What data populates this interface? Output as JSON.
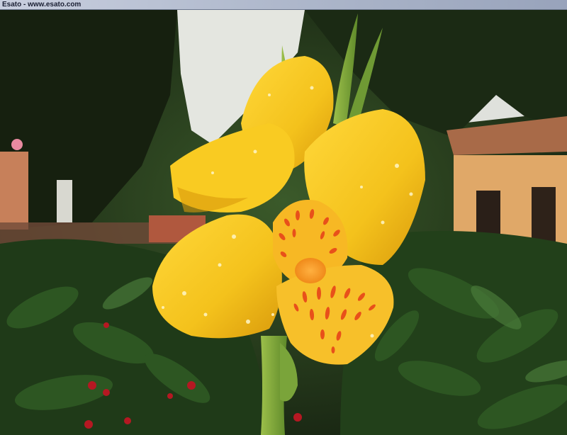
{
  "watermark": {
    "text": "Esato - www.esato.com"
  },
  "photo": {
    "subject": "yellow-canna-flower",
    "colors": {
      "petal": "#f4c21c",
      "petal_shadow": "#d99a0c",
      "spots": "#e8501a",
      "foliage": "#1f3a18",
      "sky": "#e6e8e4",
      "house_wall": "#e0a868"
    }
  }
}
